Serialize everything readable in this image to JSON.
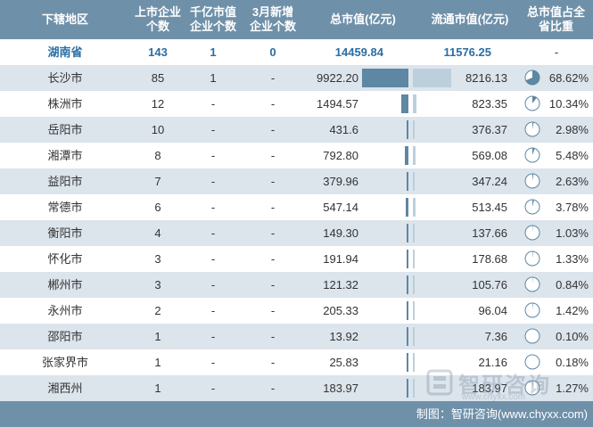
{
  "headers": {
    "region": "下辖地区",
    "listed_count": "上市企业\n个数",
    "billion_count": "千亿市值\n企业个数",
    "new_march": "3月新增\n企业个数",
    "total_value": "总市值(亿元)",
    "float_value": "流通市值(亿元)",
    "share": "总市值占全\n省比重"
  },
  "summary": {
    "region": "湖南省",
    "listed_count": "143",
    "billion_count": "1",
    "new_march": "0",
    "total_value": "14459.84",
    "float_value": "11576.25",
    "share": "-"
  },
  "chart_data": {
    "type": "table",
    "columns": [
      "下辖地区",
      "上市企业个数",
      "千亿市值企业个数",
      "3月新增企业个数",
      "总市值(亿元)",
      "流通市值(亿元)",
      "总市值占全省比重"
    ],
    "rows": [
      {
        "region": "长沙市",
        "listed_count": "85",
        "billion_count": "1",
        "new_march": "-",
        "total_value": 9922.2,
        "total_label": "9922.20",
        "float_value": 8216.13,
        "float_label": "8216.13",
        "share": 68.62,
        "share_label": "68.62%"
      },
      {
        "region": "株洲市",
        "listed_count": "12",
        "billion_count": "-",
        "new_march": "-",
        "total_value": 1494.57,
        "total_label": "1494.57",
        "float_value": 823.35,
        "float_label": "823.35",
        "share": 10.34,
        "share_label": "10.34%"
      },
      {
        "region": "岳阳市",
        "listed_count": "10",
        "billion_count": "-",
        "new_march": "-",
        "total_value": 431.6,
        "total_label": "431.6",
        "float_value": 376.37,
        "float_label": "376.37",
        "share": 2.98,
        "share_label": "2.98%"
      },
      {
        "region": "湘潭市",
        "listed_count": "8",
        "billion_count": "-",
        "new_march": "-",
        "total_value": 792.8,
        "total_label": "792.80",
        "float_value": 569.08,
        "float_label": "569.08",
        "share": 5.48,
        "share_label": "5.48%"
      },
      {
        "region": "益阳市",
        "listed_count": "7",
        "billion_count": "-",
        "new_march": "-",
        "total_value": 379.96,
        "total_label": "379.96",
        "float_value": 347.24,
        "float_label": "347.24",
        "share": 2.63,
        "share_label": "2.63%"
      },
      {
        "region": "常德市",
        "listed_count": "6",
        "billion_count": "-",
        "new_march": "-",
        "total_value": 547.14,
        "total_label": "547.14",
        "float_value": 513.45,
        "float_label": "513.45",
        "share": 3.78,
        "share_label": "3.78%"
      },
      {
        "region": "衡阳市",
        "listed_count": "4",
        "billion_count": "-",
        "new_march": "-",
        "total_value": 149.3,
        "total_label": "149.30",
        "float_value": 137.66,
        "float_label": "137.66",
        "share": 1.03,
        "share_label": "1.03%"
      },
      {
        "region": "怀化市",
        "listed_count": "3",
        "billion_count": "-",
        "new_march": "-",
        "total_value": 191.94,
        "total_label": "191.94",
        "float_value": 178.68,
        "float_label": "178.68",
        "share": 1.33,
        "share_label": "1.33%"
      },
      {
        "region": "郴州市",
        "listed_count": "3",
        "billion_count": "-",
        "new_march": "-",
        "total_value": 121.32,
        "total_label": "121.32",
        "float_value": 105.76,
        "float_label": "105.76",
        "share": 0.84,
        "share_label": "0.84%"
      },
      {
        "region": "永州市",
        "listed_count": "2",
        "billion_count": "-",
        "new_march": "-",
        "total_value": 205.33,
        "total_label": "205.33",
        "float_value": 96.04,
        "float_label": "96.04",
        "share": 1.42,
        "share_label": "1.42%"
      },
      {
        "region": "邵阳市",
        "listed_count": "1",
        "billion_count": "-",
        "new_march": "-",
        "total_value": 13.92,
        "total_label": "13.92",
        "float_value": 7.36,
        "float_label": "7.36",
        "share": 0.1,
        "share_label": "0.10%"
      },
      {
        "region": "张家界市",
        "listed_count": "1",
        "billion_count": "-",
        "new_march": "-",
        "total_value": 25.83,
        "total_label": "25.83",
        "float_value": 21.16,
        "float_label": "21.16",
        "share": 0.18,
        "share_label": "0.18%"
      },
      {
        "region": "湘西州",
        "listed_count": "1",
        "billion_count": "-",
        "new_march": "-",
        "total_value": 183.97,
        "total_label": "183.97",
        "float_value": 183.97,
        "float_label": "183.97",
        "share": 1.27,
        "share_label": "1.27%"
      }
    ]
  },
  "footer": {
    "source": "制图：智研咨询(www.chyxx.com)"
  },
  "watermark": {
    "name": "智研咨询",
    "url": "www.chyxx.com"
  },
  "colors": {
    "header_bg": "#6f90a9",
    "stripe": "#dce4ec",
    "total_bar": "#5e87a3",
    "float_bar": "#bccfdc",
    "summary_text": "#2b6ea3"
  }
}
